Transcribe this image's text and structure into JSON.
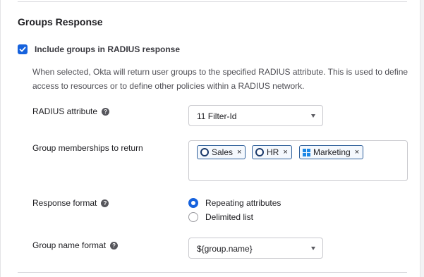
{
  "section": {
    "title": "Groups Response"
  },
  "include_groups": {
    "label": "Include groups in RADIUS response",
    "checked": true,
    "help_text": "When selected, Okta will return user groups to the specified RADIUS attribute. This is used to define access to resources or to define other policies within a RADIUS network."
  },
  "radius_attribute": {
    "label": "RADIUS attribute",
    "value": "11 Filter-Id"
  },
  "group_memberships": {
    "label": "Group memberships to return",
    "chips": [
      {
        "label": "Sales",
        "icon": "okta-group-icon",
        "remove": "×"
      },
      {
        "label": "HR",
        "icon": "okta-group-icon",
        "remove": "×"
      },
      {
        "label": "Marketing",
        "icon": "windows-icon",
        "remove": "×"
      }
    ]
  },
  "response_format": {
    "label": "Response format",
    "options": [
      {
        "label": "Repeating attributes",
        "selected": true
      },
      {
        "label": "Delimited list",
        "selected": false
      }
    ]
  },
  "group_name_format": {
    "label": "Group name format",
    "value": "${group.name}"
  },
  "colors": {
    "accent": "#1662dd",
    "chip_border": "#2e5f9a"
  }
}
